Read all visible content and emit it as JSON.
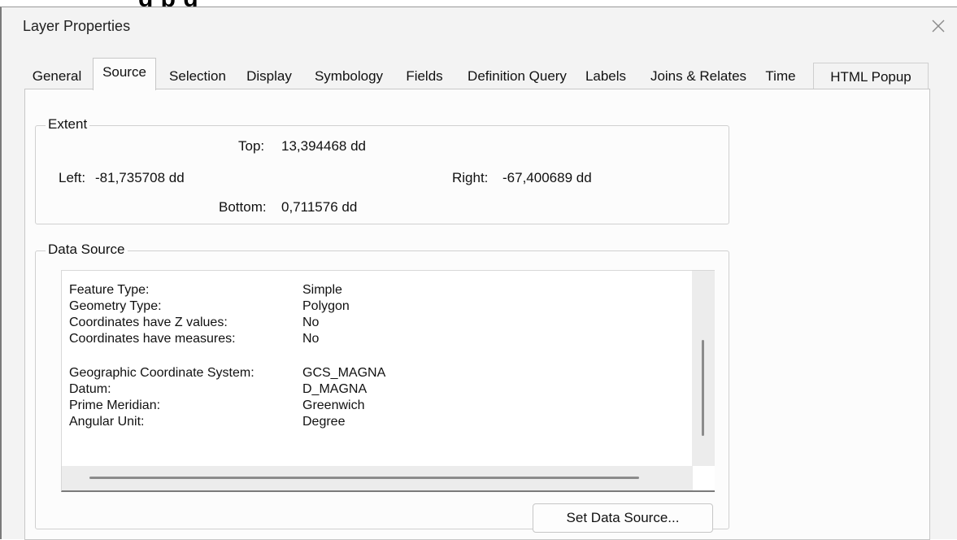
{
  "header_fragment": "g                    p  g",
  "window": {
    "title": "Layer Properties",
    "close_glyph": "×"
  },
  "tabs": [
    {
      "label": "General",
      "active": false
    },
    {
      "label": "Source",
      "active": true
    },
    {
      "label": "Selection",
      "active": false
    },
    {
      "label": "Display",
      "active": false
    },
    {
      "label": "Symbology",
      "active": false
    },
    {
      "label": "Fields",
      "active": false
    },
    {
      "label": "Definition Query",
      "active": false
    },
    {
      "label": "Labels",
      "active": false
    },
    {
      "label": "Joins & Relates",
      "active": false
    },
    {
      "label": "Time",
      "active": false
    },
    {
      "label": "HTML Popup",
      "active": false
    }
  ],
  "extent": {
    "title": "Extent",
    "top_label": "Top:",
    "top_value": "13,394468 dd",
    "left_label": "Left:",
    "left_value": "-81,735708 dd",
    "right_label": "Right:",
    "right_value": "-67,400689 dd",
    "bottom_label": "Bottom:",
    "bottom_value": "0,711576 dd"
  },
  "data_source": {
    "title": "Data Source",
    "rows": [
      {
        "key": "Feature Type:",
        "value": "Simple"
      },
      {
        "key": "Geometry Type:",
        "value": "Polygon"
      },
      {
        "key": "Coordinates have Z values:",
        "value": "No"
      },
      {
        "key": "Coordinates have measures:",
        "value": "No"
      }
    ],
    "rows2": [
      {
        "key": "Geographic Coordinate System:",
        "value": "GCS_MAGNA"
      },
      {
        "key": "Datum:",
        "value": "D_MAGNA"
      },
      {
        "key": "Prime Meridian:",
        "value": "Greenwich"
      },
      {
        "key": "Angular Unit:",
        "value": "Degree"
      }
    ]
  },
  "buttons": {
    "set_data_source": "Set Data Source..."
  }
}
